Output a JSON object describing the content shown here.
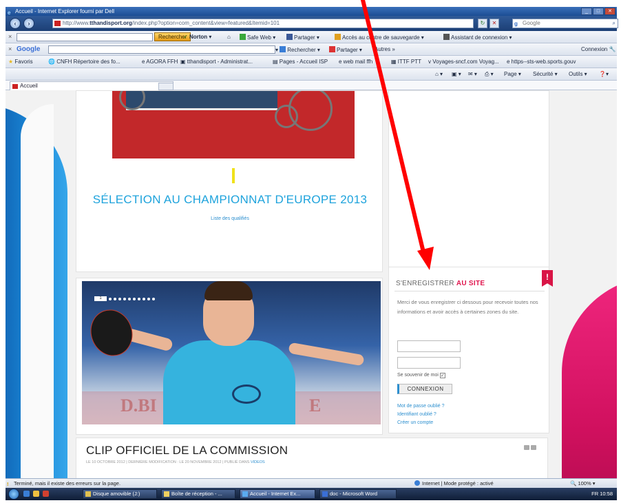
{
  "window": {
    "title": "Accueil - Internet Explorer fourni par Dell",
    "url_prefix": "http://www.",
    "url_domain": "tthandisport.org",
    "url_rest": "/index.php?option=com_content&view=featured&Itemid=101",
    "search_engine": "Google"
  },
  "norton_bar": {
    "search_button": "Rechercher",
    "norton_label": "Norton",
    "safe_web": "Safe Web",
    "share": "Partager",
    "backup": "Accès au centre de sauvegarde",
    "assistant": "Assistant de connexion"
  },
  "google_bar": {
    "logo": "Google",
    "search": "Rechercher",
    "share": "Partager",
    "more": "Autres",
    "login": "Connexion"
  },
  "favorites_bar": {
    "favorites": "Favoris",
    "items": [
      "CNFH Répertoire des fo...",
      "AGORA FFH",
      "tthandisport - Administrat...",
      "Pages - Accueil ISP",
      "web mail ffh",
      "ITTF PTT",
      "Voyages-sncf.com Voyag...",
      "https--sts-web.sports.gouv"
    ]
  },
  "command_bar": {
    "tab_title": "Accueil",
    "page_menu": "Page",
    "security_menu": "Sécurité",
    "tools_menu": "Outils"
  },
  "page": {
    "headline": "SÉLECTION AU CHAMPIONNAT D'EUROPE 2013",
    "headline_link": "Liste des qualifiés",
    "slide_active": "1",
    "slide_dot_count": 10,
    "banner_left": "D.BI",
    "banner_right": "E",
    "register": {
      "title_prefix": "S'ENREGISTRER",
      "title_highlight": "AU SITE",
      "badge": "!",
      "description": "Merci de vous enregistrer ci dessous pour recevoir toutes nos informations et avoir accès à certaines zones du site.",
      "username_placeholder": "",
      "password_placeholder": "",
      "remember_label": "Se souvenir de moi",
      "remember_checked": "✓",
      "login_button": "CONNEXION",
      "forgot_password": "Mot de passe oublié ?",
      "forgot_username": "Identifiant oublié ?",
      "create_account": "Créer un compte"
    },
    "clip": {
      "title": "CLIP OFFICIEL DE LA COMMISSION",
      "meta": "LE 10 OCTOBRE 2012 | DERNIÈRE MODIFICATION : LE 20 NOVEMBRE 2012 | PUBLIÉ DANS",
      "meta_category": "VIDEOS"
    }
  },
  "statusbar": {
    "message": "Terminé, mais il existe des erreurs sur la page.",
    "mode": "Internet | Mode protégé : activé",
    "zoom": "100%"
  },
  "taskbar": {
    "items": [
      "Disque amovible (J:)",
      "Boîte de réception - ...",
      "Accueil - Internet Ex...",
      "doc - Microsoft Word"
    ],
    "tray": "FR  10:58"
  },
  "colors": {
    "accent_blue": "#1ea3dc",
    "accent_pink": "#e0174f",
    "annotation_arrow": "#ff0000"
  }
}
